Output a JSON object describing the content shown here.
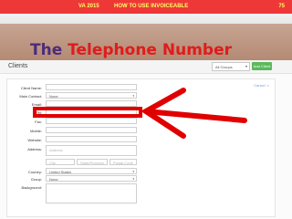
{
  "banner": {
    "course": "VA 2015",
    "title": "HOW TO USE INVOICEABLE",
    "page": "75"
  },
  "slide": {
    "title_word1": "The",
    "title_word2": "Telephone Number"
  },
  "app": {
    "heading": "Clients",
    "groups_filter": "All Groups",
    "add_client_label": "Add Client",
    "cancel_label": "Cancel",
    "form": {
      "client_name_label": "Client Name:",
      "main_contact_label": "Main Contact:",
      "main_contact_value": "None",
      "email_label": "Email:",
      "tel_label": "Tel:",
      "fax_label": "Fax:",
      "mobile_label": "Mobile:",
      "website_label": "Website:",
      "address_label": "Address:",
      "address_placeholder": "Address",
      "city_placeholder": "City",
      "state_placeholder": "State/Province",
      "postal_placeholder": "Postal Code",
      "country_label": "Country:",
      "country_value": "United States",
      "group_label": "Group:",
      "group_value": "None",
      "background_label": "Background:"
    }
  },
  "colors": {
    "banner_red": "#ee3737",
    "banner_text": "#ffff66",
    "title_purple": "#4b2d7a",
    "title_red": "#e01b1b",
    "button_green": "#5cb85c",
    "highlight_red": "#e00000"
  }
}
